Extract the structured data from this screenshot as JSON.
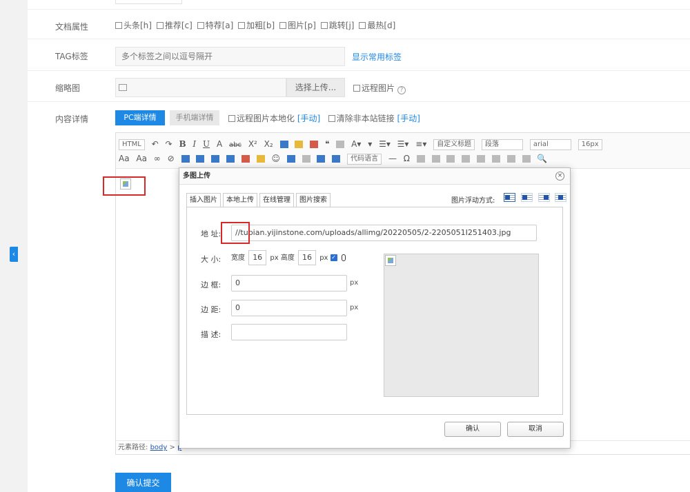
{
  "form": {
    "doc_attr_label": "文档属性",
    "doc_attrs": [
      "头条[h]",
      "推荐[c]",
      "特荐[a]",
      "加粗[b]",
      "图片[p]",
      "跳转[j]",
      "最热[d]"
    ],
    "tag_label": "TAG标签",
    "tag_placeholder": "多个标签之间以逗号隔开",
    "tag_link": "显示常用标签",
    "thumb_label": "缩略图",
    "upload_button": "选择上传...",
    "remote_image": "远程图片",
    "content_label": "内容详情",
    "tab_pc": "PC端详情",
    "tab_mobile": "手机端详情",
    "opt_localize": "远程图片本地化",
    "opt_localize_link": "[手动]",
    "opt_clear_links": "清除非本站链接",
    "opt_clear_link": "[手动]",
    "submit": "确认提交"
  },
  "editor": {
    "toolbar": {
      "html": "HTML",
      "custom_title": "自定义标题",
      "paragraph": "段落",
      "font": "arial",
      "font_size": "16px",
      "code_lang": "代码语言"
    },
    "status_prefix": "元素路径:",
    "status_path": "body",
    "status_sep": ">",
    "status_p": "p"
  },
  "dialog": {
    "title": "多图上传",
    "close": "×",
    "tabs": [
      "插入图片",
      "本地上传",
      "在线管理",
      "图片搜索"
    ],
    "float_label": "图片浮动方式:",
    "address_label": "地 址:",
    "address_value": "//tupian.yijinstone.com/uploads/allimg/20220505/2-2205051I251403.jpg",
    "size_label": "大 小:",
    "width_label": "宽度",
    "width_value": "16",
    "px1": "px",
    "height_label": "高度",
    "height_value": "16",
    "px2": "px",
    "border_label": "边 框:",
    "border_value": "0",
    "border_unit": "px",
    "margin_label": "边 距:",
    "margin_value": "0",
    "margin_unit": "px",
    "desc_label": "描 述:",
    "desc_value": "",
    "ok": "确认",
    "cancel": "取消"
  },
  "sidebar": {
    "collapse_icon": "chevron-left-icon"
  },
  "colors": {
    "accent": "#1e88e5",
    "highlight": "#d62828"
  }
}
